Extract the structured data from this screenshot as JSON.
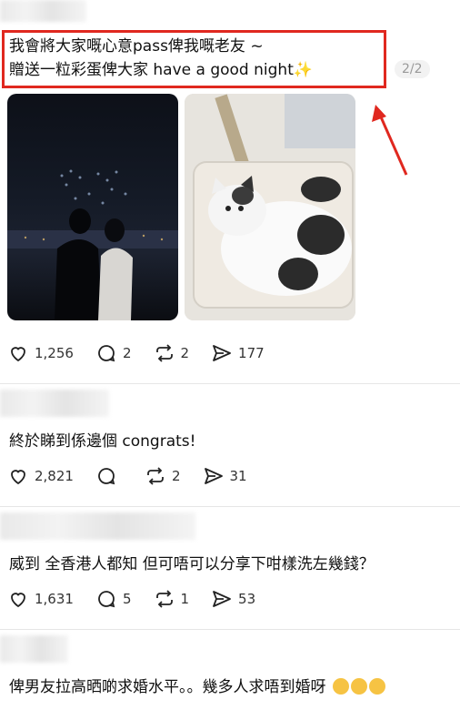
{
  "post": {
    "line1": "我會將大家嘅心意pass俾我嘅老友 ~",
    "line2": "￼贈送一粒彩蛋俾大家￼ have a good night",
    "page_indicator": "2/2",
    "images": [
      {
        "icon": "night-scene-couple-drone-show"
      },
      {
        "icon": "white-black-cat-in-chair"
      }
    ],
    "actions": {
      "likes": "1,256",
      "comments": "2",
      "reposts": "2",
      "shares": "177"
    }
  },
  "comments": [
    {
      "text": "終於睇到係邊個 congrats!",
      "likes": "2,821",
      "comments": "",
      "reposts": "2",
      "shares": "31"
    },
    {
      "text": "威到 全香港人都知 但可唔可以分享下咁樣洗左幾錢？",
      "likes": "1,631",
      "comments": "5",
      "reposts": "1",
      "shares": "53"
    },
    {
      "text": "俾男友拉高晒啲求婚水平。。幾多人求唔到婚呀",
      "emoji": "laughing-emoji"
    }
  ],
  "annotation": {
    "highlight_color": "#e0281f"
  }
}
